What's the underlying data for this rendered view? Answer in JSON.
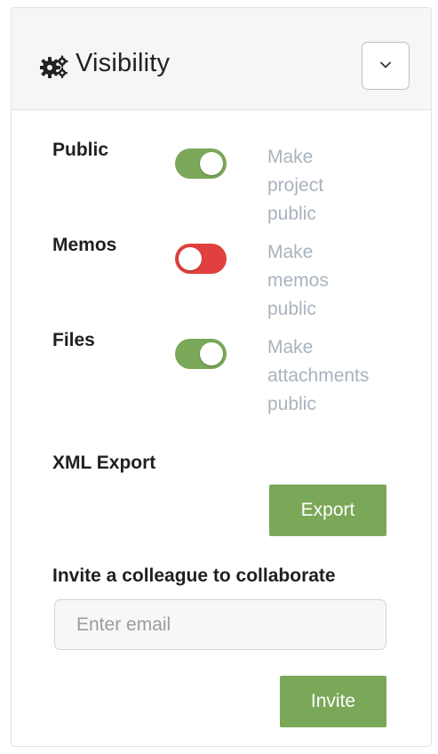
{
  "header": {
    "title": "Visibility",
    "icon": "cogs-icon",
    "collapse_icon": "chevron-down-icon"
  },
  "settings": [
    {
      "label": "Public",
      "enabled": true,
      "desc_lines": [
        "Make",
        "project",
        "public"
      ]
    },
    {
      "label": "Memos",
      "enabled": false,
      "desc_lines": [
        "Make",
        "memos",
        "public"
      ]
    },
    {
      "label": "Files",
      "enabled": true,
      "desc_lines": [
        "Make",
        "attachments",
        "public"
      ]
    }
  ],
  "xml_export": {
    "label": "XML Export",
    "button_label": "Export"
  },
  "invite": {
    "label": "Invite a colleague to collaborate",
    "placeholder": "Enter email",
    "value": "",
    "button_label": "Invite"
  },
  "colors": {
    "toggle_on": "#7ba759",
    "toggle_off": "#e0403e",
    "button": "#7ba759",
    "description": "#a9b3bd"
  }
}
